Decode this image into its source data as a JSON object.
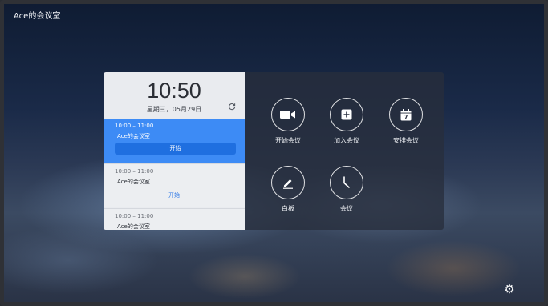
{
  "room_title": "Ace的会议室",
  "clock": {
    "time": "10:50",
    "date": "星期三，05月29日"
  },
  "meetings": [
    {
      "time": "10:00 – 11:00",
      "name": "Ace的会议室",
      "action": "开始"
    },
    {
      "time": "10:00 – 11:00",
      "name": "Ace的会议室",
      "action": "开始"
    },
    {
      "time": "10:00 – 11:00",
      "name": "Ace的会议室"
    }
  ],
  "actions": [
    {
      "label": "开始会议",
      "icon": "video-camera-icon"
    },
    {
      "label": "加入会议",
      "icon": "plus-square-icon"
    },
    {
      "label": "安排会议",
      "icon": "calendar-icon",
      "calendar_day": "7"
    },
    {
      "label": "白板",
      "icon": "pencil-icon"
    },
    {
      "label": "会议",
      "icon": "clock-icon"
    }
  ],
  "colors": {
    "accent": "#3d8bf5",
    "button": "#1f6fe0",
    "link": "#2e78e6"
  }
}
